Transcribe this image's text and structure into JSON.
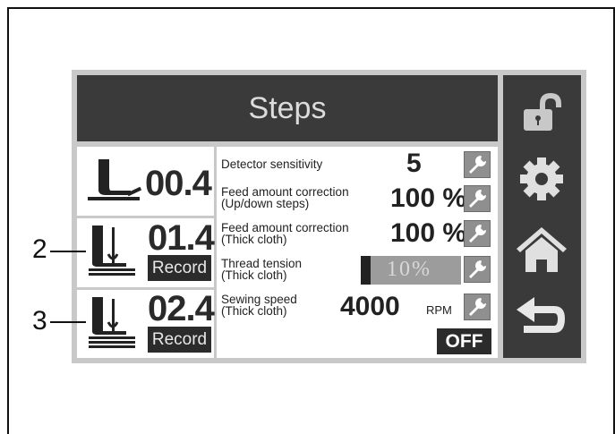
{
  "header": {
    "title": "Steps"
  },
  "steps": [
    {
      "number": "00.4"
    },
    {
      "number": "01.4",
      "button": "Record",
      "callout": "2"
    },
    {
      "number": "02.4",
      "button": "Record",
      "callout": "3"
    }
  ],
  "settings": [
    {
      "label_line1": "Detector sensitivity",
      "value": "5"
    },
    {
      "label_line1": "Feed amount correction",
      "label_line2": "(Up/down steps)",
      "value": "100 %"
    },
    {
      "label_line1": "Feed amount correction",
      "label_line2": "(Thick cloth)",
      "value": "100 %"
    },
    {
      "label_line1": "Thread tension",
      "label_line2": "(Thick cloth)",
      "value": "10%",
      "level_percent": 10
    },
    {
      "label_line1": "Sewing speed",
      "label_line2": "(Thick cloth)",
      "value": "4000",
      "unit": "RPM"
    }
  ],
  "toggle": {
    "label": "OFF"
  },
  "sidebar": {
    "icons": [
      "unlock-icon",
      "gear-icon",
      "home-icon",
      "back-icon"
    ]
  },
  "colors": {
    "dark": "#3a3a3a",
    "frame": "#c9c9c9",
    "button": "#8f8f8f"
  }
}
